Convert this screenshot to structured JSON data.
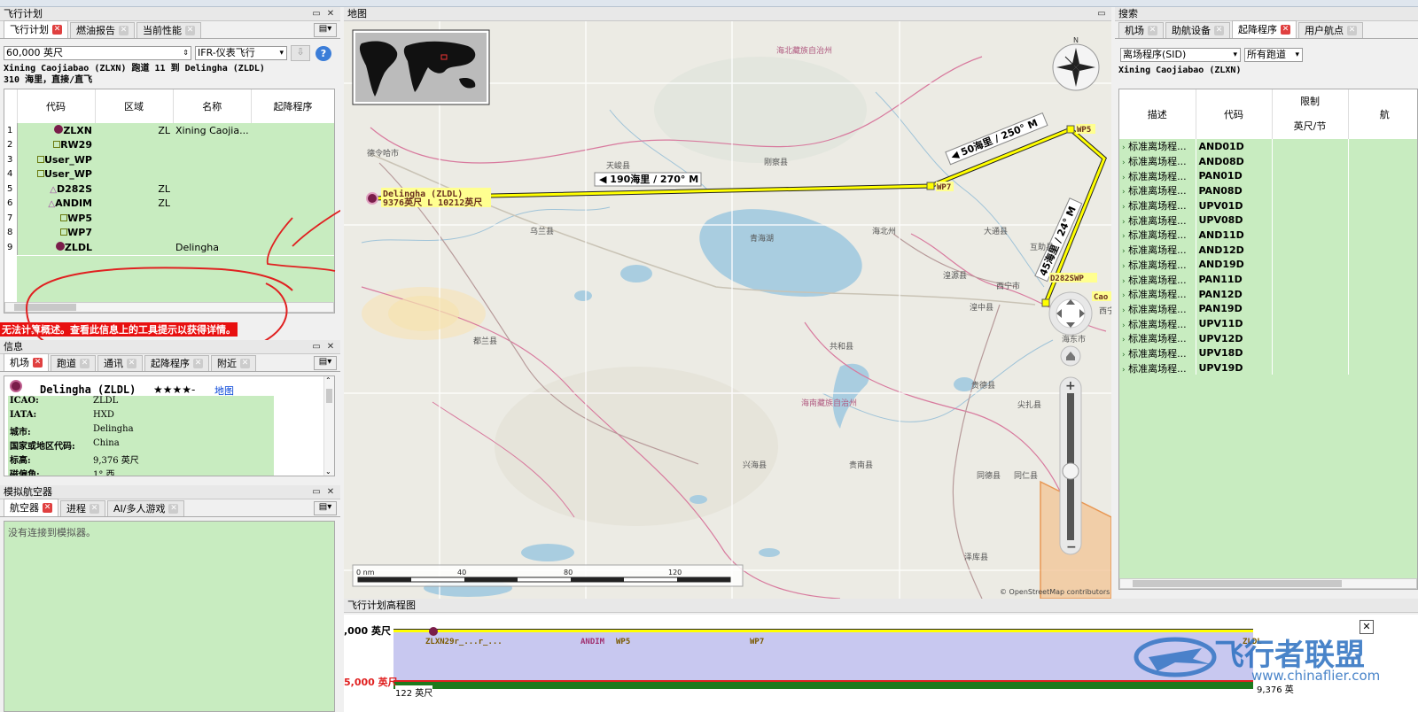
{
  "flight_plan_panel": {
    "title": "飞行计划",
    "tabs": [
      "飞行计划",
      "燃油报告",
      "当前性能"
    ],
    "altitude_value": "60,000 英尺",
    "flight_type": "IFR-仪表飞行",
    "route_line1": "Xining Caojiabao (ZLXN) 跑道 11 到 Delingha (ZLDL)",
    "route_line2": "310 海里，直接/直飞",
    "columns": [
      "代码",
      "区域",
      "名称",
      "起降程序"
    ],
    "rows": [
      {
        "n": "1",
        "code": "ZLXN",
        "region": "ZL",
        "name": "Xining Caojia...",
        "type": "airport"
      },
      {
        "n": "2",
        "code": "RW29",
        "region": "",
        "name": "",
        "type": "wp"
      },
      {
        "n": "3",
        "code": "User_WP",
        "region": "",
        "name": "",
        "type": "wp"
      },
      {
        "n": "4",
        "code": "User_WP",
        "region": "",
        "name": "",
        "type": "wp"
      },
      {
        "n": "5",
        "code": "D282S",
        "region": "ZL",
        "name": "",
        "type": "ndb"
      },
      {
        "n": "6",
        "code": "ANDIM",
        "region": "ZL",
        "name": "",
        "type": "ndb"
      },
      {
        "n": "7",
        "code": "WP5",
        "region": "",
        "name": "",
        "type": "wp"
      },
      {
        "n": "8",
        "code": "WP7",
        "region": "",
        "name": "",
        "type": "wp"
      },
      {
        "n": "9",
        "code": "ZLDL",
        "region": "",
        "name": "Delingha",
        "type": "airport"
      }
    ],
    "error_message": "无法计算概述。查看此信息上的工具提示以获得详情。"
  },
  "info_panel": {
    "title": "信息",
    "tabs": [
      "机场",
      "跑道",
      "通讯",
      "起降程序",
      "附近"
    ],
    "airport_title": "Delingha (ZLDL)",
    "stars": "★★★★-",
    "map_link": "地图",
    "fields": [
      {
        "label": "ICAO:",
        "value": "ZLDL"
      },
      {
        "label": "IATA:",
        "value": "HXD"
      },
      {
        "label": "城市:",
        "value": "Delingha"
      },
      {
        "label": "国家或地区代码:",
        "value": "China"
      },
      {
        "label": "标高:",
        "value": "9,376 英尺"
      },
      {
        "label": "磁偏角:",
        "value": "1° 西"
      }
    ]
  },
  "sim_panel": {
    "title": "模拟航空器",
    "tabs": [
      "航空器",
      "进程",
      "AI/多人游戏"
    ],
    "status": "没有连接到模拟器。"
  },
  "map_panel": {
    "title": "地图",
    "leg1": "◀ 190海里 / 270° M",
    "leg2": "◀ 50海里 / 250° M",
    "leg3": "45海里 / 24° M",
    "dest_label1": "Delingha (ZLDL)",
    "dest_label2": "9376英尺 L 10212英尺",
    "wp5": "WP5",
    "wp7": "WP7",
    "d282": "D282SWP",
    "cao": "Cao",
    "compass_n": "N",
    "scale": [
      "0 nm",
      "40",
      "80",
      "120"
    ],
    "attribution": "© OpenStreetMap contributors",
    "places": [
      {
        "t": "德令哈市"
      },
      {
        "t": "天峻县"
      },
      {
        "t": "刚察县"
      },
      {
        "t": "乌兰县"
      },
      {
        "t": "青海湖"
      },
      {
        "t": "海北州"
      },
      {
        "t": "西宁市"
      },
      {
        "t": "海北藏族自治州"
      },
      {
        "t": "都兰县"
      },
      {
        "t": "共和县"
      },
      {
        "t": "海南藏族自治州"
      },
      {
        "t": "兴海县"
      },
      {
        "t": "贵南县"
      },
      {
        "t": "同德县"
      },
      {
        "t": "湟源县"
      },
      {
        "t": "湟中县"
      },
      {
        "t": "大通县"
      },
      {
        "t": "互助县"
      },
      {
        "t": "贵德县"
      },
      {
        "t": "尖扎县"
      },
      {
        "t": "同仁县"
      },
      {
        "t": "泽库县"
      },
      {
        "t": "西宁"
      },
      {
        "t": "海东市"
      }
    ]
  },
  "profile_panel": {
    "title": "飞行计划高程图",
    "alt_top": ",000 英尺",
    "alt_bottom": "5,000 英尺",
    "ground": "122 英尺",
    "end_alt": "9,376 英",
    "labels": [
      "ZLXN29r_...r_...",
      "ANDIM",
      "WP5",
      "WP7",
      "ZLDL"
    ]
  },
  "search_panel": {
    "title": "搜索",
    "tabs": [
      "机场",
      "助航设备",
      "起降程序",
      "用户航点"
    ],
    "proc_type": "离场程序(SID)",
    "runway_filter": "所有跑道",
    "airport": "Xining Caojiabao (ZLXN)",
    "columns": [
      "描述",
      "代码",
      "限制",
      "航"
    ],
    "sub_column": "英尺/节",
    "rows": [
      {
        "desc": "标准离场程...",
        "code": "AND01D"
      },
      {
        "desc": "标准离场程...",
        "code": "AND08D"
      },
      {
        "desc": "标准离场程...",
        "code": "PAN01D"
      },
      {
        "desc": "标准离场程...",
        "code": "PAN08D"
      },
      {
        "desc": "标准离场程...",
        "code": "UPV01D"
      },
      {
        "desc": "标准离场程...",
        "code": "UPV08D"
      },
      {
        "desc": "标准离场程...",
        "code": "AND11D"
      },
      {
        "desc": "标准离场程...",
        "code": "AND12D"
      },
      {
        "desc": "标准离场程...",
        "code": "AND19D"
      },
      {
        "desc": "标准离场程...",
        "code": "PAN11D"
      },
      {
        "desc": "标准离场程...",
        "code": "PAN12D"
      },
      {
        "desc": "标准离场程...",
        "code": "PAN19D"
      },
      {
        "desc": "标准离场程...",
        "code": "UPV11D"
      },
      {
        "desc": "标准离场程...",
        "code": "UPV12D"
      },
      {
        "desc": "标准离场程...",
        "code": "UPV18D"
      },
      {
        "desc": "标准离场程...",
        "code": "UPV19D"
      }
    ]
  },
  "watermark": {
    "text": "飞行者联盟",
    "url": "www.chinaflier.com"
  }
}
